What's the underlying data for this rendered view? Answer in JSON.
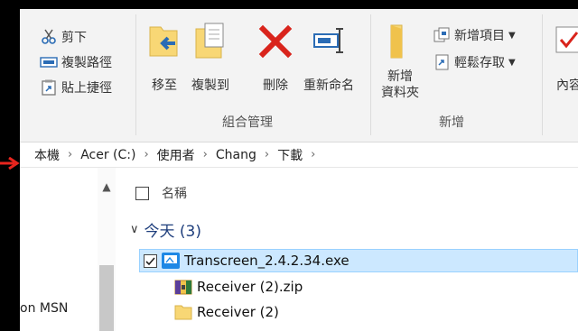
{
  "ribbon": {
    "clipboard": {
      "cut": "剪下",
      "copy_path": "複製路徑",
      "paste_shortcut": "貼上捷徑"
    },
    "organize": {
      "move_to": "移至",
      "copy_to": "複製到",
      "delete": "刪除",
      "rename": "重新命名",
      "label": "組合管理"
    },
    "new": {
      "new_folder_line1": "新增",
      "new_folder_line2": "資料夾",
      "new_item": "新增項目",
      "easy_access": "輕鬆存取",
      "label": "新增"
    },
    "open": {
      "properties": "內容"
    }
  },
  "address": {
    "crumbs": [
      "本機",
      "Acer (C:)",
      "使用者",
      "Chang",
      "下載"
    ]
  },
  "nav": {
    "partial_item": "on MSN"
  },
  "filelist": {
    "column_name": "名稱",
    "group_label": "今天 (3)",
    "files": [
      {
        "name": "Transcreen_2.4.2.34.exe",
        "selected": true
      },
      {
        "name": "Receiver (2).zip",
        "selected": false
      },
      {
        "name": "Receiver (2)",
        "selected": false
      }
    ]
  },
  "colors": {
    "selection": "#cce8ff",
    "delete_red": "#d9241c",
    "folder_yellow": "#f8d775",
    "arrow_red": "#e8251e"
  }
}
